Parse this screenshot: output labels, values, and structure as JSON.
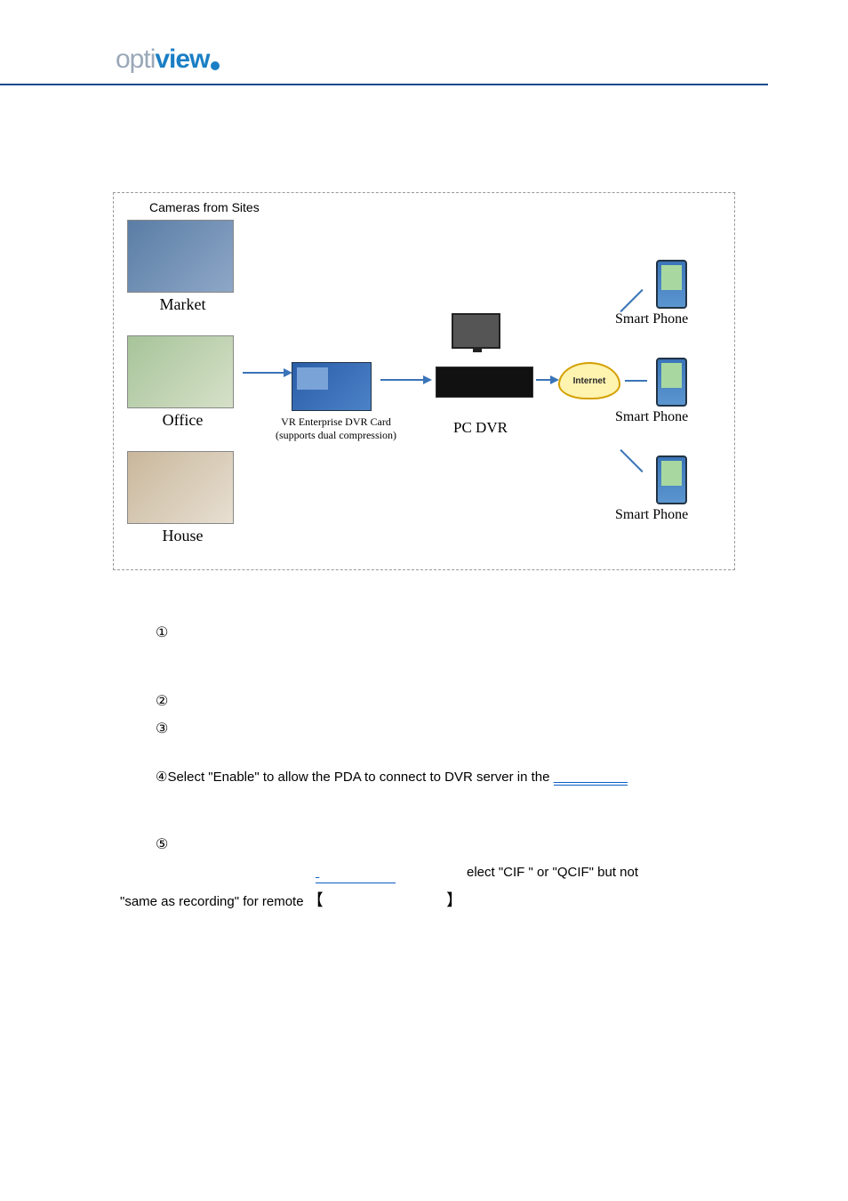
{
  "logo": {
    "part1": "opti",
    "part2": "view"
  },
  "diagram": {
    "heading": "Cameras from Sites",
    "camera_labels": [
      "Market",
      "Office",
      "House"
    ],
    "dvr_card": {
      "title": "VR Enterprise DVR Card",
      "sub": "(supports dual compression)"
    },
    "pc_dvr": "PC DVR",
    "internet": "Internet",
    "phone_label": "Smart Phone"
  },
  "steps": {
    "s1": "①",
    "s2": "②",
    "s3": "③",
    "s4_pre": "④Select \"Enable\" to allow the PDA to connect to DVR server in the ",
    "s4_linkpad": "                    ",
    "s5": "⑤",
    "line_elect": "elect \"CIF \" or \"QCIF\" but not",
    "line_same_pre": "\"same as recording\" for remote ",
    "line_same_bracket_open": "【",
    "line_same_bracket_close": "】"
  }
}
